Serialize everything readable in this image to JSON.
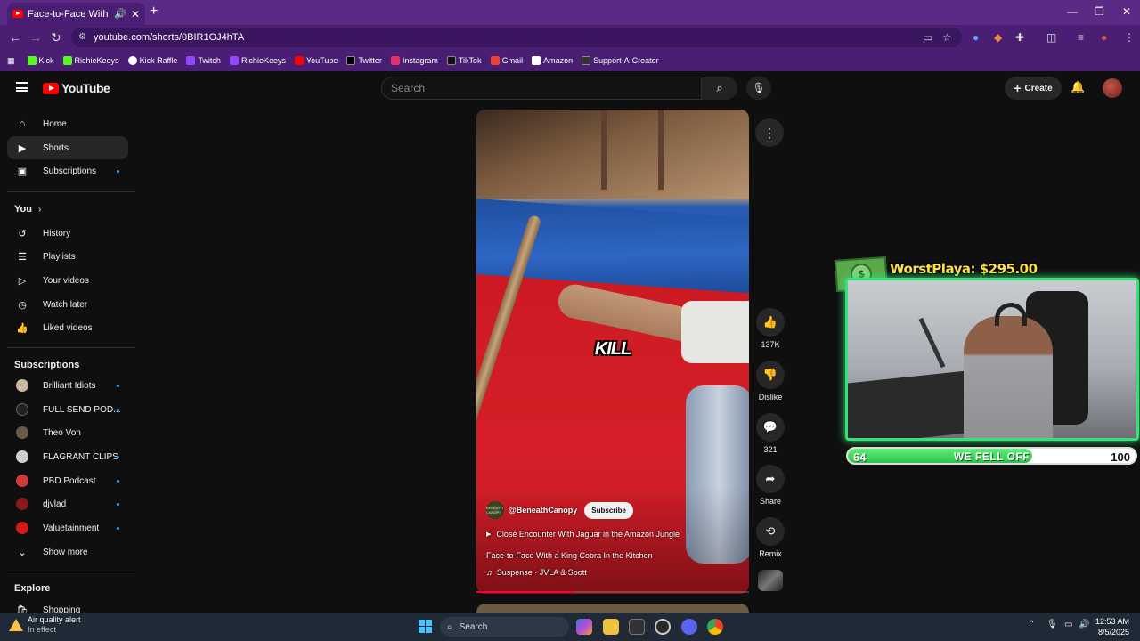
{
  "browser": {
    "tab_title": "Face-to-Face With a King C",
    "url": "youtube.com/shorts/0BIR1OJ4hTA",
    "bookmarks": [
      {
        "label": "Kick",
        "color": "#53fc18"
      },
      {
        "label": "RichieKeeys",
        "color": "#53fc18"
      },
      {
        "label": "Kick Raffle",
        "color": "#ffffff"
      },
      {
        "label": "Twitch",
        "color": "#9146ff"
      },
      {
        "label": "RichieKeeys",
        "color": "#9146ff"
      },
      {
        "label": "YouTube",
        "color": "#ff0000"
      },
      {
        "label": "Twitter",
        "color": "#000000"
      },
      {
        "label": "Instagram",
        "color": "#e1306c"
      },
      {
        "label": "TikTok",
        "color": "#111111"
      },
      {
        "label": "Gmail",
        "color": "#ea4335"
      },
      {
        "label": "Amazon",
        "color": "#ff9900"
      },
      {
        "label": "Support-A-Creator",
        "color": "#333333"
      }
    ]
  },
  "header": {
    "logo_text": "YouTube",
    "search_placeholder": "Search",
    "create_label": "Create"
  },
  "sidebar": {
    "main": [
      {
        "label": "Home",
        "icon": "home-icon"
      },
      {
        "label": "Shorts",
        "icon": "shorts-icon",
        "active": true
      },
      {
        "label": "Subscriptions",
        "icon": "subscriptions-icon",
        "dot": true
      }
    ],
    "you_heading": "You",
    "you_items": [
      {
        "label": "History",
        "icon": "history-icon"
      },
      {
        "label": "Playlists",
        "icon": "playlists-icon"
      },
      {
        "label": "Your videos",
        "icon": "your-videos-icon"
      },
      {
        "label": "Watch later",
        "icon": "watch-later-icon"
      },
      {
        "label": "Liked videos",
        "icon": "liked-videos-icon"
      }
    ],
    "subscriptions_heading": "Subscriptions",
    "subscriptions": [
      {
        "label": "Brilliant Idiots",
        "color": "#c8b8a0"
      },
      {
        "label": "FULL SEND POD...",
        "color": "#111111"
      },
      {
        "label": "Theo Von",
        "color": "#6a5a4a"
      },
      {
        "label": "FLAGRANT CLIPS",
        "color": "#cfcfcf"
      },
      {
        "label": "PBD Podcast",
        "color": "#d23a3a"
      },
      {
        "label": "djvlad",
        "color": "#8a1a1a"
      },
      {
        "label": "Valuetainment",
        "color": "#d11a1a"
      }
    ],
    "show_more": "Show more",
    "explore_heading": "Explore",
    "explore_items": [
      {
        "label": "Shopping",
        "icon": "shopping-icon"
      }
    ]
  },
  "short": {
    "caption_word": "KILL",
    "channel_handle": "@BeneathCanopy",
    "channel_avatar_text": "BENEATH CANOPY",
    "subscribe_label": "Subscribe",
    "related_video": "Close Encounter With Jaguar in the Amazon Jungle",
    "title": "Face-to-Face With a King Cobra In the Kitchen",
    "music": "Suspense · JVLA & Spott",
    "progress": 0.36
  },
  "actions": {
    "like_count": "137K",
    "dislike_label": "Dislike",
    "comment_count": "321",
    "share_label": "Share",
    "remix_label": "Remix"
  },
  "overlay": {
    "donation": "WorstPlaya: $295.00",
    "bar_left": "64",
    "bar_text": "WE FELL OFF",
    "bar_right": "100",
    "bar_fill": 0.64
  },
  "taskbar": {
    "weather_title": "Air quality alert",
    "weather_sub": "In effect",
    "search_label": "Search",
    "time": "12:53 AM",
    "date": "8/5/2025"
  }
}
